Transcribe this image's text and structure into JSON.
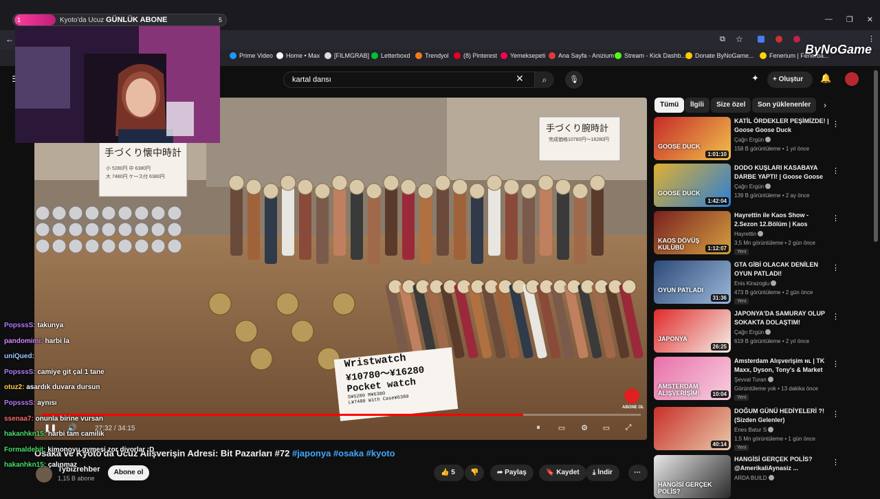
{
  "browser": {
    "tab": {
      "badge": "1",
      "title_prefix": "Kyoto'da Ucuz",
      "title_bold": "GÜNLÜK ABONE",
      "count": "5"
    },
    "window_controls": [
      "—",
      "❐",
      "✕"
    ],
    "bookmarks": [
      {
        "label": "Prime Video",
        "color": "#1a98ff"
      },
      {
        "label": "Home • Max",
        "color": "#ffffff"
      },
      {
        "label": "[FILMGRAB]",
        "color": "#dddddd"
      },
      {
        "label": "Letterboxd",
        "color": "#00c030"
      },
      {
        "label": "Trendyol",
        "color": "#f27a1a"
      },
      {
        "label": "(8) Pinterest",
        "color": "#e60023"
      },
      {
        "label": "Yemeksepeti",
        "color": "#fa0050"
      },
      {
        "label": "Ana Sayfa - Anizium",
        "color": "#e03a3a"
      },
      {
        "label": "Stream - Kick Dashb...",
        "color": "#53fc18"
      },
      {
        "label": "Donate ByNoGame...",
        "color": "#ffcc00"
      },
      {
        "label": "Fenerium | Fenerba...",
        "color": "#ffd400"
      }
    ],
    "brand": "ByNoGame"
  },
  "youtube": {
    "search_value": "kartal dansı",
    "create_label": "Oluştur"
  },
  "video": {
    "time": "27:32 / 34:15",
    "progress": 0.804,
    "title_prefix": "Osaka ve Kyoto'da Ucuz Alışverişin Adresi: Bit Pazarları #72",
    "hashtags": [
      "#japonya",
      "#osaka",
      "#kyoto"
    ],
    "sign_wristwatch": "Wristwatch",
    "sign_price1": "¥10780〜¥16280",
    "sign_pocket": "Pocket watch",
    "sign_small1": "S¥5280",
    "sign_small2": "L¥7480",
    "sign_small3": "M¥6380",
    "sign_small4": "With Case¥6380",
    "jp_sign_left": "手づくり懐中時計",
    "jp_sign_right": "手づくり腕時計",
    "jp_sign_right_sub": "完成価格10780円〜16280円",
    "jp_left_sub1": "小 5280円   中 6380円",
    "jp_left_sub2": "大 7480円   ケース付 6380円",
    "subscribe_sticker": "ABONE OL"
  },
  "channel": {
    "name": "Tybizrehber",
    "subs": "1,15 B abone",
    "subscribe": "Abone ol"
  },
  "actions": {
    "likes": "5",
    "share": "Paylaş",
    "save": "Kaydet",
    "download": "İndir"
  },
  "chat": [
    {
      "user": "PopsssS:",
      "msg": "takunya",
      "color": "#b47cff"
    },
    {
      "user": "pandomimi:",
      "msg": "harbi la",
      "color": "#d38bff"
    },
    {
      "user": "uniQued:",
      "msg": "",
      "color": "#9ec8ff"
    },
    {
      "user": "PopsssS:",
      "msg": "camiye git çal 1 tane",
      "color": "#b47cff"
    },
    {
      "user": "otuz2:",
      "msg": "asardık duvara dursun",
      "color": "#ffd24a"
    },
    {
      "user": "PopsssS:",
      "msg": "aynısı",
      "color": "#b47cff"
    },
    {
      "user": "ssenaa7:",
      "msg": "onunla birine vursan",
      "color": "#ff6a6a"
    },
    {
      "user": "hakanhkn15:",
      "msg": "harbi tam camilik",
      "color": "#48e06b"
    },
    {
      "user": "Formaldehit:",
      "msg": "kimonoyu gymesi zor diyorlar :D",
      "color": "#48e06b"
    },
    {
      "user": "hakanhkn15:",
      "msg": "çalınmaz",
      "color": "#48e06b"
    }
  ],
  "sidebar": {
    "chips": [
      "Tümü",
      "İlgili",
      "Size özel",
      "Son yüklenenler"
    ],
    "recommendations": [
      {
        "title": "KATİL ÖRDEKLER PEŞİMİZDE! | Goose Goose Duck",
        "channel": "Çağrı Ergün",
        "meta": "158 B görüntüleme • 1 yıl önce",
        "duration": "1:01:10",
        "new": "",
        "thumb_text": "GOOSE DUCK",
        "colors": [
          "#c62a2a",
          "#f0c24b"
        ]
      },
      {
        "title": "DODO KUŞLARI KASABAYA DARBE YAPTI! | Goose Goose ...",
        "channel": "Çağrı Ergün",
        "meta": "139 B görüntüleme • 2 ay önce",
        "duration": "1:42:04",
        "new": "",
        "thumb_text": "GOOSE DUCK",
        "colors": [
          "#e0b030",
          "#2a7fd6"
        ]
      },
      {
        "title": "Hayrettin ile Kaos Show - 2.Sezon 12.Bölüm | Kaos Dövü...",
        "channel": "Hayrettin",
        "meta": "3,5 Mn görüntüleme • 2 gün önce",
        "duration": "1:12:07",
        "new": "Yeni",
        "thumb_text": "KAOS DÖVÜŞ KULÜBÜ",
        "colors": [
          "#7a2020",
          "#d4a040"
        ]
      },
      {
        "title": "GTA GİBİ OLACAK DENİLEN OYUN PATLADI! TÜRKİYE'DEKİ...",
        "channel": "Enis Kirazoglu",
        "meta": "473 B görüntüleme • 2 gün önce",
        "duration": "31:36",
        "new": "Yeni",
        "thumb_text": "OYUN PATLADI",
        "colors": [
          "#2c4a78",
          "#9bb8d8"
        ]
      },
      {
        "title": "JAPONYA'DA SAMURAY OLUP SOKAKTA DOLAŞTIM! (EFSAN...",
        "channel": "Çağrı Ergün",
        "meta": "619 B görüntüleme • 2 yıl önce",
        "duration": "26:25",
        "new": "",
        "thumb_text": "JAPONYA",
        "colors": [
          "#e02a2a",
          "#f5f0e8"
        ]
      },
      {
        "title": "Amsterdam Alışverişim ɴʟ | TK Maxx, Dyson, Tony's & Market ...",
        "channel": "Şevval Turan",
        "meta": "Görüntüleme yok • 13 dakika önce",
        "duration": "10:04",
        "new": "Yeni",
        "thumb_text": "AMSTERDAM ALIŞVERİŞİM!",
        "colors": [
          "#e86fa8",
          "#f6d0e0"
        ]
      },
      {
        "title": "DOĞUM GÜNÜ HEDİYELERİ ?! (Sizden Gelenler)",
        "channel": "Enes Batur S",
        "meta": "1,5 Mn görüntüleme • 1 gün önce",
        "duration": "40:14",
        "new": "Yeni",
        "thumb_text": "",
        "colors": [
          "#c8302a",
          "#e8c8a8"
        ]
      },
      {
        "title": "HANGİSİ GERÇEK POLİS? @AmerikaliAynasiz ...",
        "channel": "ARDA BUILD",
        "meta": "",
        "duration": "",
        "new": "",
        "thumb_text": "HANGİSİ GERÇEK POLİS?",
        "colors": [
          "#e8e8e8",
          "#2a2a2a"
        ]
      }
    ]
  }
}
